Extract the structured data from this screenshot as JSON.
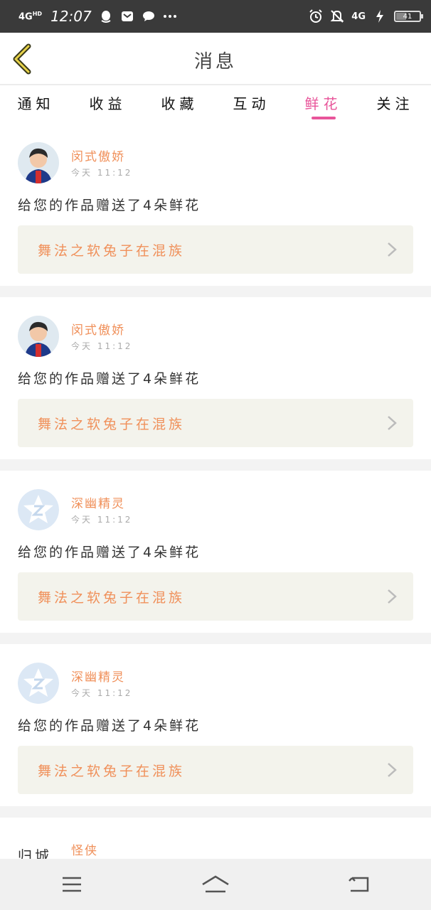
{
  "status_bar": {
    "network": "4G",
    "network_sup": "HD",
    "time": "12:07",
    "right_network": "4G",
    "battery": "41",
    "battery_level": 0.41
  },
  "header": {
    "title": "消息",
    "back_icon": "chevron-left-icon"
  },
  "tabs": [
    {
      "label": "通知",
      "active": false
    },
    {
      "label": "收益",
      "active": false
    },
    {
      "label": "收藏",
      "active": false
    },
    {
      "label": "互动",
      "active": false
    },
    {
      "label": "鲜花",
      "active": true
    },
    {
      "label": "关注",
      "active": false
    }
  ],
  "notifications": [
    {
      "name": "闵式傲娇",
      "time": "今天 11:12",
      "message": "给您的作品赠送了4朵鲜花",
      "work_title": "舞法之软兔子在混族",
      "avatar": "photo"
    },
    {
      "name": "闵式傲娇",
      "time": "今天 11:12",
      "message": "给您的作品赠送了4朵鲜花",
      "work_title": "舞法之软兔子在混族",
      "avatar": "photo"
    },
    {
      "name": "深幽精灵",
      "time": "今天 11:12",
      "message": "给您的作品赠送了4朵鲜花",
      "work_title": "舞法之软兔子在混族",
      "avatar": "default"
    },
    {
      "name": "深幽精灵",
      "time": "今天 11:12",
      "message": "给您的作品赠送了4朵鲜花",
      "work_title": "舞法之软兔子在混族",
      "avatar": "default"
    },
    {
      "name": "怪侠",
      "avatar_text": "归城"
    }
  ],
  "colors": {
    "accent": "#e8559a",
    "name": "#f0905a",
    "status_bar": "#3a3a3a",
    "work_bg": "#f3f3ec"
  },
  "nav": {
    "menu_icon": "menu-icon",
    "home_icon": "home-icon",
    "back_icon": "back-icon"
  }
}
